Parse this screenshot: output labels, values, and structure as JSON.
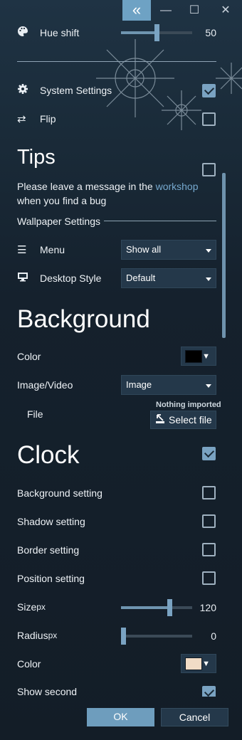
{
  "window": {
    "collapse_glyph": "«",
    "minimize_glyph": "—",
    "maximize_glyph": "☐",
    "close_glyph": "✕"
  },
  "hue": {
    "label": "Hue shift",
    "value": "50",
    "level": 0.5
  },
  "system_settings": {
    "label": "System Settings",
    "checked": true
  },
  "flip": {
    "label": "Flip",
    "checked": false
  },
  "tips": {
    "title": "Tips",
    "checked": false,
    "message_pre": "Please leave a message in the ",
    "message_link": "workshop",
    "message_post": "when you find a bug"
  },
  "wallpaper": {
    "section_label": "Wallpaper Settings",
    "menu_label": "Menu",
    "menu_value": "Show all",
    "desktop_label": "Desktop Style",
    "desktop_value": "Default"
  },
  "background": {
    "title": "Background",
    "color_label": "Color",
    "color_value": "#000000",
    "image_label": "Image/Video",
    "image_value": "Image",
    "file_label": "File",
    "file_status": "Nothing imported",
    "file_button": "Select file"
  },
  "clock": {
    "title": "Clock",
    "checked": true,
    "bg_label": "Background setting",
    "shadow_label": "Shadow setting",
    "border_label": "Border setting",
    "position_label": "Position setting",
    "size_label": "Size",
    "size_unit": "px",
    "size_value": "120",
    "size_level": 0.7,
    "radius_label": "Radius",
    "radius_unit": "px",
    "radius_value": "0",
    "radius_level": 0.0,
    "color_label": "Color",
    "color_value": "#f1dcc6",
    "show_second_label": "Show second",
    "show_second_checked": true
  },
  "footer": {
    "ok": "OK",
    "cancel": "Cancel"
  },
  "colors": {
    "accent": "#7aa3c2",
    "button": "#6e9dbd",
    "link": "#76a9cf"
  },
  "icons": [
    "palette-icon",
    "gear-icon",
    "swap-arrows-icon",
    "menu-lines-icon",
    "monitor-icon",
    "file-import-icon"
  ]
}
